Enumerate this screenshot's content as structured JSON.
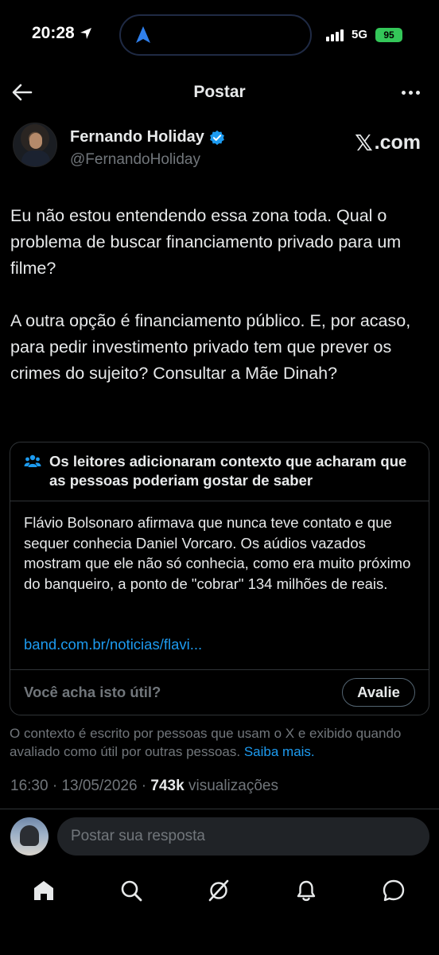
{
  "status": {
    "time": "20:28",
    "network": "5G",
    "battery": "95"
  },
  "header": {
    "title": "Postar"
  },
  "author": {
    "name": "Fernando Holiday",
    "handle": "@FernandoHoliday",
    "source": ".com",
    "source_glyph": "𝕏"
  },
  "post": {
    "paragraphs": [
      "Eu não estou entendendo essa zona toda. Qual o problema de buscar financiamento privado para um filme?",
      "A outra opção é financiamento público. E, por acaso, para pedir investimento privado tem que prever os crimes do sujeito?  Consultar a Mãe Dinah?"
    ]
  },
  "community_note": {
    "title": "Os leitores adicionaram contexto que acharam que as pessoas poderiam gostar de saber",
    "body": "Flávio Bolsonaro afirmava que nunca teve contato e que sequer conhecia Daniel Vorcaro. Os aúdios vazados mostram que ele não só conhecia, como era muito próximo do banqueiro, a ponto de \"cobrar\" 134 milhões de reais.",
    "link": "band.com.br/noticias/flavi...",
    "question": "Você acha isto útil?",
    "rate_label": "Avalie"
  },
  "disclaimer": {
    "text": "O contexto é escrito por pessoas que usam o X e exibido quando avaliado como útil por outras pessoas. ",
    "learn_more": "Saiba mais."
  },
  "meta": {
    "time": "16:30",
    "date": "13/05/2026",
    "views_count": "743k",
    "views_label": "visualizações"
  },
  "reply": {
    "placeholder": "Postar sua resposta"
  },
  "tabs": [
    "home-icon",
    "search-icon",
    "grok-icon",
    "notifications-icon",
    "messages-icon"
  ],
  "colors": {
    "accent": "#1d9bf0",
    "muted": "#71767b",
    "border": "#2f3336",
    "battery": "#34c759"
  }
}
